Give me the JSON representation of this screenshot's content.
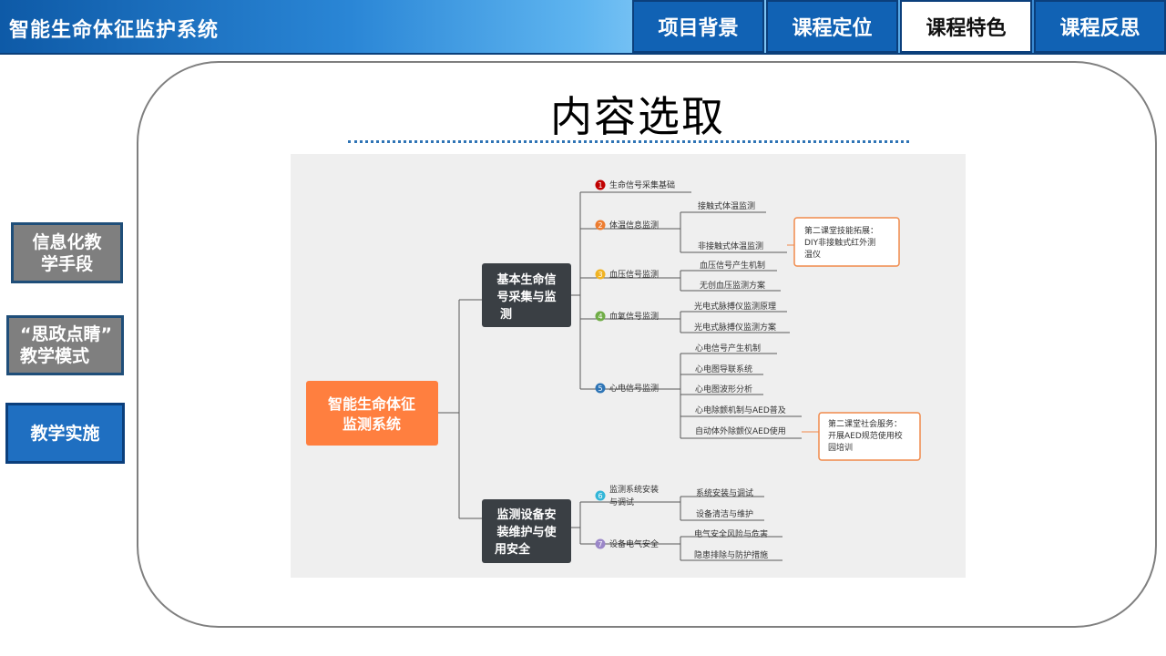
{
  "header": {
    "app_title": "智能生命体征监护系统",
    "tabs": [
      {
        "label": "项目背景",
        "active": false
      },
      {
        "label": "课程定位",
        "active": false
      },
      {
        "label": "课程特色",
        "active": true
      },
      {
        "label": "课程反思",
        "active": false
      }
    ]
  },
  "sidebar": {
    "buttons": [
      {
        "label_line1": "信息化教",
        "label_line2": "学手段"
      },
      {
        "label_line1": "“思政点睛”",
        "label_line2": "教学模式"
      },
      {
        "label": "教学实施"
      }
    ]
  },
  "main": {
    "title": "内容选取"
  },
  "mindmap": {
    "root": {
      "line1": "智能生命体征",
      "line2": "监测系统"
    },
    "branch1": {
      "line1": "基本生命信",
      "line2": "号采集与监",
      "line3": "测"
    },
    "branch2": {
      "line1": "监测设备安",
      "line2": "装维护与使",
      "line3": "用安全"
    },
    "topics": [
      {
        "num": "1",
        "color": "#c00000",
        "label": "生命信号采集基础"
      },
      {
        "num": "2",
        "color": "#ed7d31",
        "label": "体温信息监测"
      },
      {
        "num": "3",
        "color": "#f0b323",
        "label": "血压信号监测"
      },
      {
        "num": "4",
        "color": "#70ad47",
        "label": "血氧信号监测"
      },
      {
        "num": "5",
        "color": "#2e75b6",
        "label": "心电信号监测"
      },
      {
        "num": "6",
        "color": "#33b6d8",
        "label_line1": "监测系统安装",
        "label_line2": "与调试"
      },
      {
        "num": "7",
        "color": "#9b87c8",
        "label": "设备电气安全"
      }
    ],
    "subtopics": {
      "temp": [
        "接触式体温监测",
        "非接触式体温监测"
      ],
      "bp": [
        "血压信号产生机制",
        "无创血压监测方案"
      ],
      "spo2": [
        "光电式脉搏仪监测原理",
        "光电式脉搏仪监测方案"
      ],
      "ecg": [
        "心电信号产生机制",
        "心电图导联系统",
        "心电图波形分析",
        "心电除颤机制与AED普及",
        "自动体外除颤仪AED使用"
      ],
      "install": [
        "系统安装与调试",
        "设备清洁与维护"
      ],
      "safety": [
        "电气安全风险与危害",
        "隐患排除与防护措施"
      ]
    },
    "callouts": [
      {
        "line1": "第二课堂技能拓展：",
        "line2": "DIY非接触式红外测",
        "line3": "温仪"
      },
      {
        "line1": "第二课堂社会服务：",
        "line2": "开展AED规范使用校",
        "line3": "园培训"
      }
    ],
    "colors": {
      "root": "#ff7f3f",
      "branch": "#3a3f44",
      "callout_border": "#f08a4b",
      "line": "#5a5a5a"
    }
  }
}
